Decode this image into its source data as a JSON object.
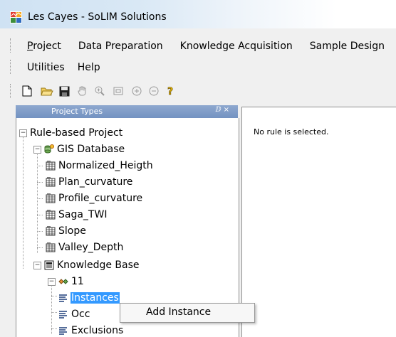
{
  "window": {
    "title": "Les Cayes - SoLIM Solutions"
  },
  "menu": {
    "row1": [
      {
        "label": "Project",
        "mnemonic": "P",
        "rest": "roject"
      },
      {
        "label": "Data Preparation"
      },
      {
        "label": "Knowledge Acquisition"
      },
      {
        "label": "Sample Design"
      }
    ],
    "row2": [
      {
        "label": "Utilities"
      },
      {
        "label": "Help"
      }
    ]
  },
  "toolbar": {
    "icons": [
      "new-document-icon",
      "open-folder-icon",
      "save-icon",
      "pan-hand-icon",
      "zoom-in-magnifier-icon",
      "full-extent-icon",
      "zoom-in-icon",
      "zoom-out-icon",
      "help-icon"
    ]
  },
  "project_types": {
    "header": "Project Types",
    "pin": "ⅅ ×"
  },
  "tree": {
    "root": "Rule-based Project",
    "gis": "GIS Database",
    "layers": [
      "Normalized_Heigth",
      "Plan_curvature",
      "Profile_curvature",
      "Saga_TWI",
      "Slope",
      "Valley_Depth"
    ],
    "kb": "Knowledge Base",
    "rule": "11",
    "children": [
      "Instances",
      "Occ",
      "Exclusions"
    ]
  },
  "right_panel": {
    "message": "No rule is selected."
  },
  "context_menu": {
    "item": "Add Instance"
  }
}
